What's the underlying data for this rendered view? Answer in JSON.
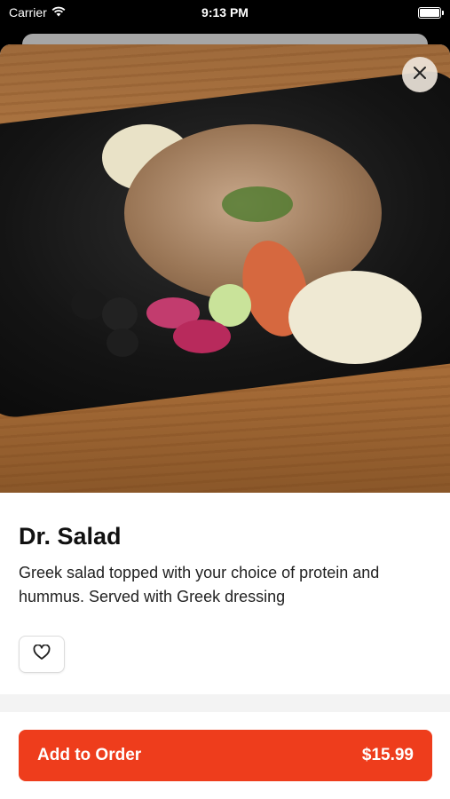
{
  "status_bar": {
    "carrier": "Carrier",
    "time": "9:13 PM",
    "icons": [
      "wifi-icon",
      "battery-icon"
    ]
  },
  "close_icon": "close-icon",
  "item": {
    "name": "Dr. Salad",
    "description": "Greek salad topped with your choice of protein and hummus. Served with Greek dressing",
    "favorite_icon": "heart-icon"
  },
  "order_button": {
    "label": "Add to Order",
    "price": "$15.99"
  },
  "colors": {
    "accent": "#ee3d1c",
    "text": "#111111"
  }
}
